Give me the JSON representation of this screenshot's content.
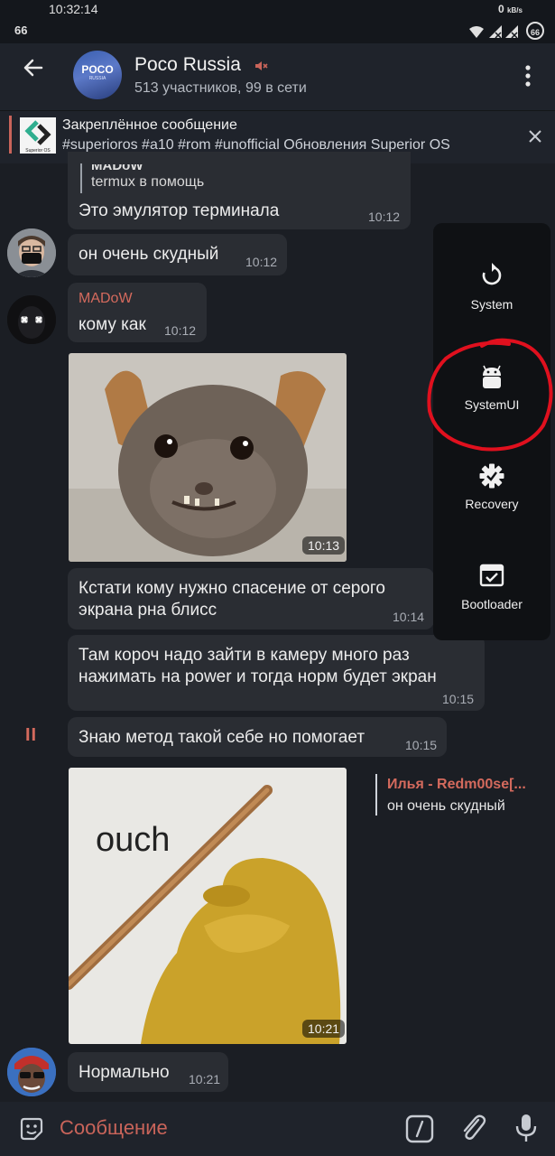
{
  "status_bar": {
    "time": "10:32:14",
    "left_number": "66",
    "speed_value": "0",
    "speed_unit": "kB/s",
    "battery": "66"
  },
  "header": {
    "title": "Poco Russia",
    "subtitle": "513 участников, 99 в сети",
    "avatar_line1": "POCO",
    "avatar_line2": "RUSSIA"
  },
  "pinned": {
    "title": "Закреплённое сообщение",
    "text": "#superioros #a10 #rom #unofficial  Обновления Superior OS",
    "thumb_caption": "Superior OS"
  },
  "messages": {
    "m1": {
      "quote_author": "MADoW",
      "quote_text": "termux в помощь",
      "text": "Это эмулятор терминала",
      "time": "10:12"
    },
    "m2": {
      "text": "он очень скудный",
      "time": "10:12"
    },
    "m3": {
      "author": "MADoW",
      "text": "кому как",
      "time": "10:12"
    },
    "m4": {
      "time": "10:13"
    },
    "m5": {
      "line1": "Кстати кому нужно спасение от серого",
      "line2": "экрана рна блисс",
      "time": "10:14"
    },
    "m6": {
      "line1": "Там короч надо зайти в камеру много раз",
      "line2": "нажимать на power и тогда норм будет экран",
      "time": "10:15"
    },
    "m7": {
      "marker": "II",
      "text": "Знаю метод такой себе но помогает",
      "time": "10:15"
    },
    "m8": {
      "image_text": "ouch",
      "time": "10:21",
      "reply_author": "Илья - Redm00se[...",
      "reply_text": "он очень скудный"
    },
    "m9": {
      "text": "Нормально",
      "time": "10:21"
    }
  },
  "power_menu": {
    "items": [
      {
        "label": "System",
        "icon": "restart-icon"
      },
      {
        "label": "SystemUI",
        "icon": "android-icon"
      },
      {
        "label": "Recovery",
        "icon": "recovery-gear-icon"
      },
      {
        "label": "Bootloader",
        "icon": "bootloader-icon"
      }
    ]
  },
  "composer": {
    "placeholder": "Сообщение"
  },
  "colors": {
    "background": "#1b1e24",
    "bubble": "#2a2d33",
    "accent_red": "#d46a5d",
    "menu_bg": "#0f1114",
    "annotation_circle": "#e0101e"
  }
}
